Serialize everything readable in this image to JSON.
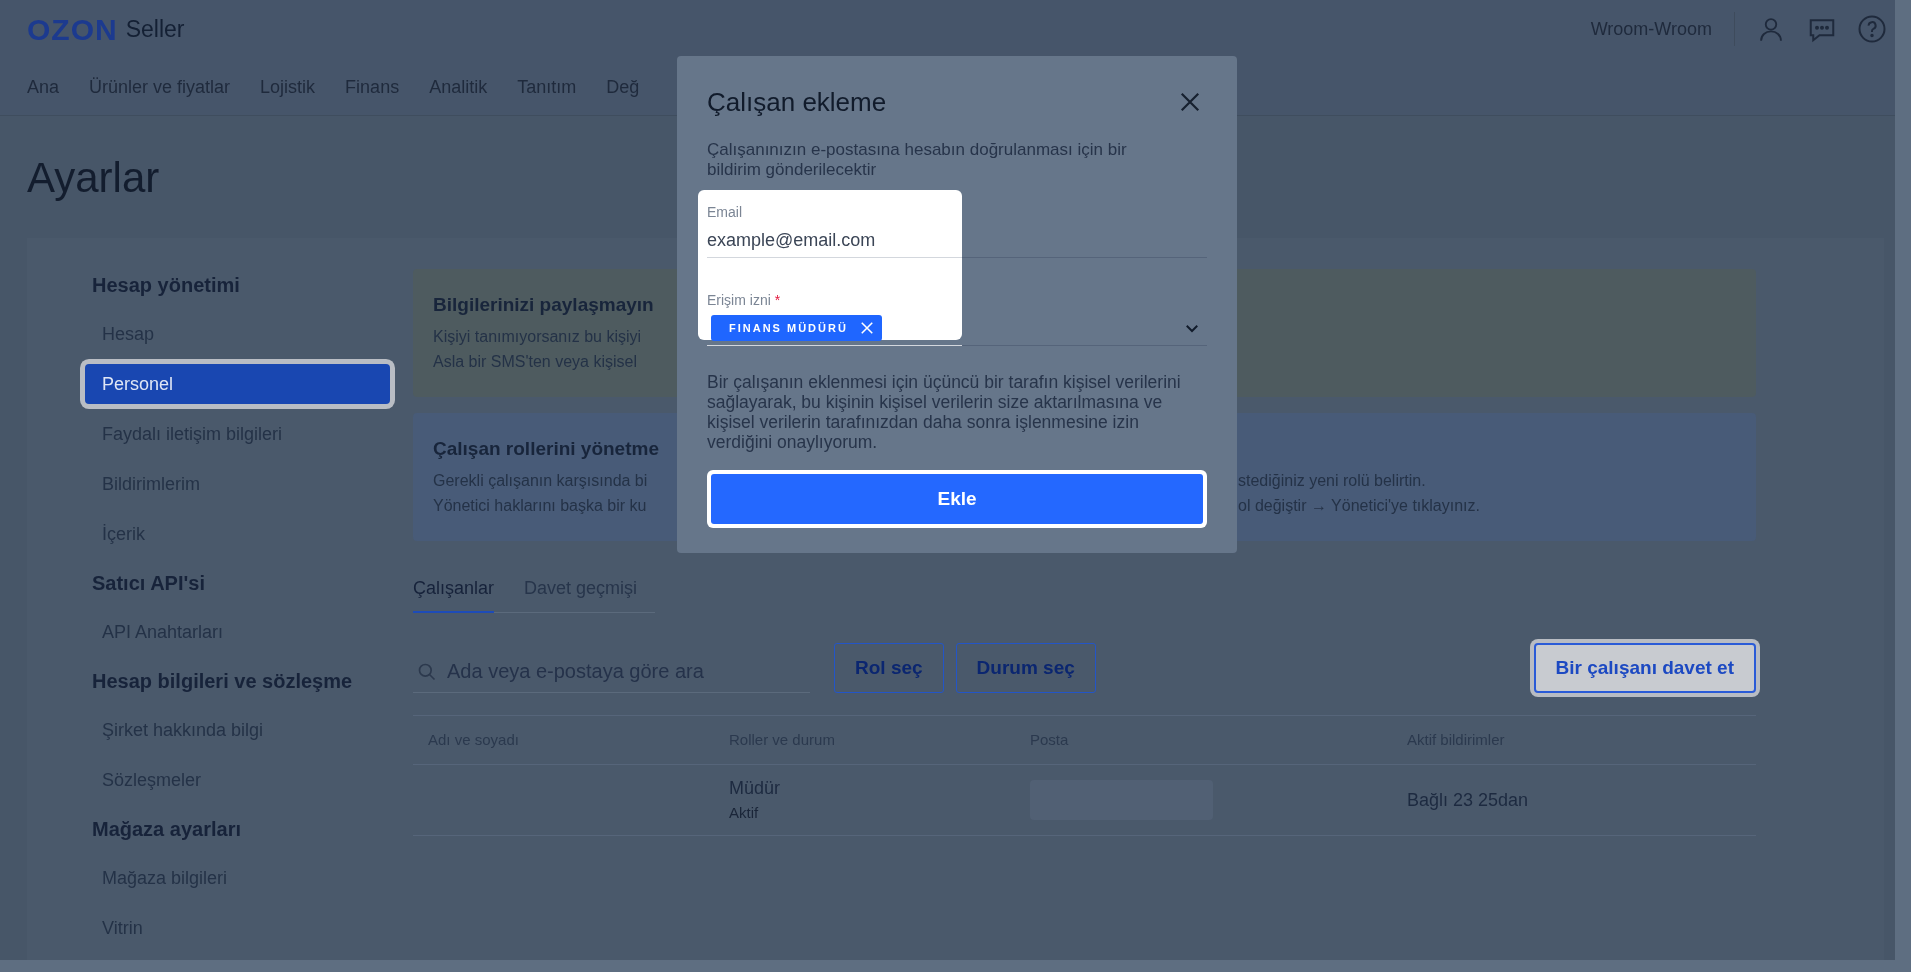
{
  "header": {
    "logo": "OZON",
    "logo_suffix": "Seller",
    "account": "Wroom-Wroom",
    "nav": [
      {
        "label": "Ana"
      },
      {
        "label": "Ürünler ve fiyatlar"
      },
      {
        "label": "Lojistik"
      },
      {
        "label": "Finans"
      },
      {
        "label": "Analitik"
      },
      {
        "label": "Tanıtım"
      },
      {
        "label": "Değ"
      }
    ]
  },
  "page_title": "Ayarlar",
  "sidebar": {
    "sections": [
      {
        "heading": "Hesap yönetimi",
        "items": [
          {
            "label": "Hesap",
            "selected": false
          },
          {
            "label": "Personel",
            "selected": true
          },
          {
            "label": "Faydalı iletişim bilgileri",
            "selected": false
          },
          {
            "label": "Bildirimlerim",
            "selected": false
          },
          {
            "label": "İçerik",
            "selected": false
          }
        ]
      },
      {
        "heading": "Satıcı API'si",
        "items": [
          {
            "label": "API Anahtarları",
            "selected": false
          }
        ]
      },
      {
        "heading": "Hesap bilgileri ve sözleşme",
        "items": [
          {
            "label": "Şirket hakkında bilgi",
            "selected": false
          },
          {
            "label": "Sözleşmeler",
            "selected": false
          }
        ]
      },
      {
        "heading": "Mağaza ayarları",
        "items": [
          {
            "label": "Mağaza bilgileri",
            "selected": false
          },
          {
            "label": "Vitrin",
            "selected": false
          }
        ]
      }
    ]
  },
  "notices": [
    {
      "kind": "warning",
      "title": "Bilgilerinizi paylaşmayın",
      "lines": [
        {
          "left": "Kişiyi tanımıyorsanız bu kişiyi"
        },
        {
          "left": "Asla bir SMS'ten veya kişisel"
        }
      ]
    },
    {
      "kind": "info",
      "title": "Çalışan rollerini yönetme",
      "lines": [
        {
          "left": "Gerekli çalışanın karşısında bi",
          "right": "stediğiniz yeni rolü belirtin."
        },
        {
          "left": "Yönetici haklarını başka bir ku",
          "right": "ol değiştir → Yönetici'ye tıklayınız."
        }
      ]
    }
  ],
  "tabs": [
    {
      "label": "Çalışanlar",
      "selected": true
    },
    {
      "label": "Davet geçmişi",
      "selected": false
    }
  ],
  "search": {
    "placeholder": "Ada veya e-postaya göre ara"
  },
  "filters": [
    "Rol seç",
    "Durum seç"
  ],
  "invite_button": "Bir çalışanı davet et",
  "table": {
    "columns": [
      "Adı ve soyadı",
      "Roller ve durum",
      "Posta",
      "Aktif bildirimler"
    ],
    "rows": [
      {
        "role": "Müdür",
        "status": "Aktif",
        "notifications": "Bağlı 23 25dan"
      }
    ]
  },
  "modal": {
    "title": "Çalışan ekleme",
    "description": "Çalışanınızın e-postasına hesabın doğrulanması için bir bildirim gönderilecektir",
    "fields": [
      {
        "kind": "text",
        "label": "Email",
        "value": "example@email.com"
      },
      {
        "kind": "select",
        "label": "Erişim izni",
        "required_mark": "*",
        "chips": [
          "FINANS MÜDÜRÜ"
        ]
      }
    ],
    "consent": "Bir çalışanın eklenmesi için üçüncü bir tarafın kişisel verilerini sağlayarak, bu kişinin kişisel verilerin size aktarılmasına ve kişisel verilerin tarafınızdan daha sonra işlenmesine izin verdiğini onaylıyorum.",
    "submit": "Ekle"
  }
}
